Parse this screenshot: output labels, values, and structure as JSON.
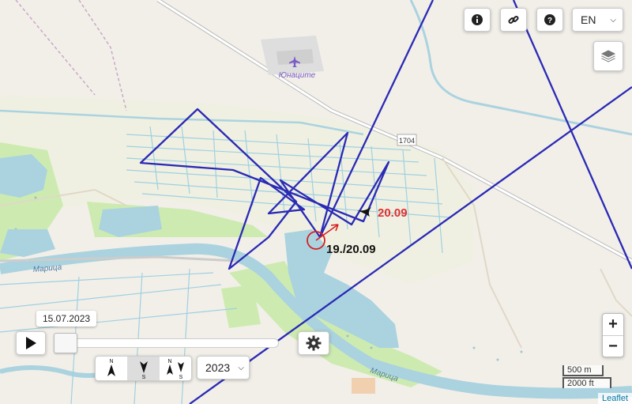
{
  "map": {
    "place_label": "Юнаците",
    "road_ref": "1704",
    "river_label": "Марица",
    "river_label_2": "Марица",
    "annotation_red": "20.09",
    "annotation_black": "19./20.09"
  },
  "toolbar": {
    "info_icon": "info-icon",
    "link_icon": "link-icon",
    "help_icon": "help-icon",
    "language": "EN",
    "layers_icon": "layers-icon"
  },
  "zoom": {
    "in_label": "+",
    "out_label": "−"
  },
  "scale": {
    "metric": "500 m",
    "imperial": "2000 ft"
  },
  "attribution": "Leaflet",
  "playback": {
    "date": "15.07.2023",
    "progress": 0.0,
    "year": "2023",
    "orientation_options": [
      {
        "top": "N",
        "bottom": ""
      },
      {
        "top": "",
        "bottom": "S"
      },
      {
        "top": "N",
        "bottom": "S"
      }
    ],
    "orientation_selected": 1
  },
  "colors": {
    "track": "#2a2ab5",
    "annotation_red": "#e03030",
    "water": "#aad3df",
    "meadow": "#cdebb0",
    "land": "#f2efe9"
  }
}
